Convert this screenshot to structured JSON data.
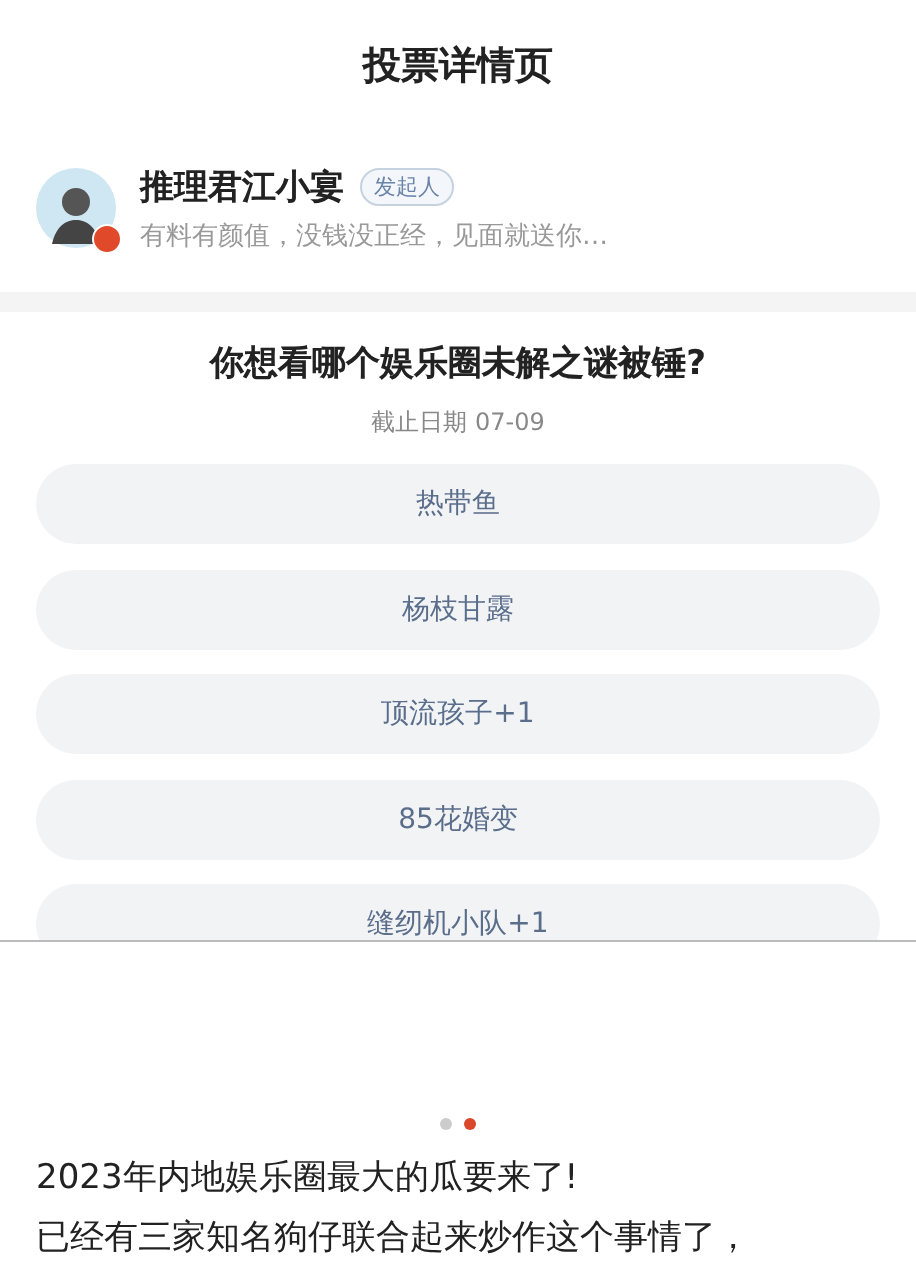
{
  "header": {
    "title": "投票详情页"
  },
  "author": {
    "name": "推理君江小宴",
    "badge": "发起人",
    "bio": "有料有颜值，没钱没正经，见面就送你…",
    "verified": true
  },
  "poll": {
    "question": "你想看哪个娱乐圈未解之谜被锤?",
    "deadline": "截止日期 07-09",
    "options": [
      {
        "label": "热带鱼"
      },
      {
        "label": "杨枝甘露"
      },
      {
        "label": "顶流孩子+1"
      },
      {
        "label": "85花婚变"
      },
      {
        "label": "缝纫机小队+1"
      }
    ]
  },
  "carousel": {
    "dots": [
      {
        "selected": false
      },
      {
        "selected": true
      }
    ]
  },
  "article": {
    "lines": [
      "2023年内地娱乐圈最大的瓜要来了!",
      "已经有三家知名狗仔联合起来炒作这个事情了，"
    ]
  }
}
